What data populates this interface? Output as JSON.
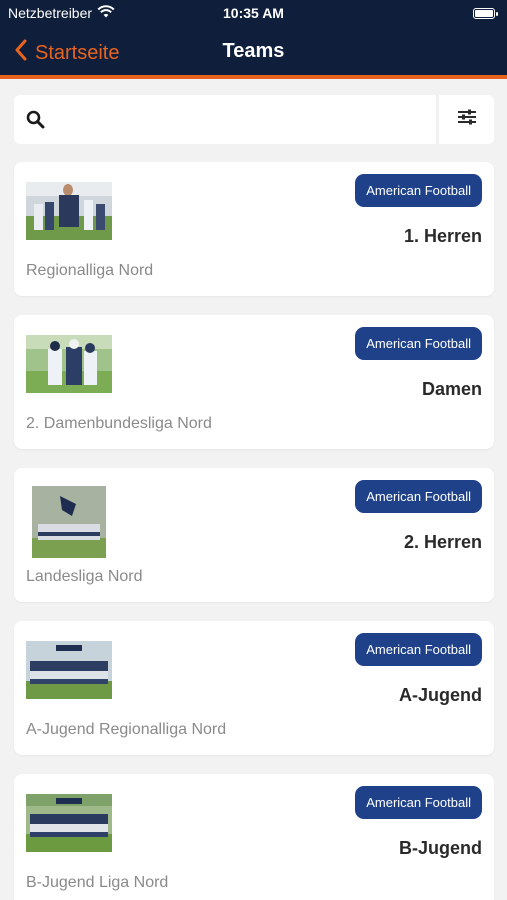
{
  "status_bar": {
    "carrier": "Netzbetreiber",
    "time": "10:35 AM",
    "wifi_icon": "wifi-icon",
    "battery_icon": "battery-icon"
  },
  "nav": {
    "back_label": "Startseite",
    "title": "Teams",
    "back_icon": "chevron-left-icon"
  },
  "search": {
    "value": "",
    "placeholder": "",
    "search_icon": "search-icon",
    "filter_icon": "sliders-icon"
  },
  "colors": {
    "header_bg": "#0f1e3b",
    "accent": "#e8641e",
    "badge_bg": "#1e4189",
    "page_bg": "#f2f2f2"
  },
  "teams": [
    {
      "badge": "American Football",
      "name": "1. Herren",
      "league": "Regionalliga Nord"
    },
    {
      "badge": "American Football",
      "name": "Damen",
      "league": "2. Damenbundesliga Nord"
    },
    {
      "badge": "American Football",
      "name": "2. Herren",
      "league": "Landesliga Nord"
    },
    {
      "badge": "American Football",
      "name": "A-Jugend",
      "league": "A-Jugend Regionalliga Nord"
    },
    {
      "badge": "American Football",
      "name": "B-Jugend",
      "league": "B-Jugend Liga Nord"
    }
  ]
}
